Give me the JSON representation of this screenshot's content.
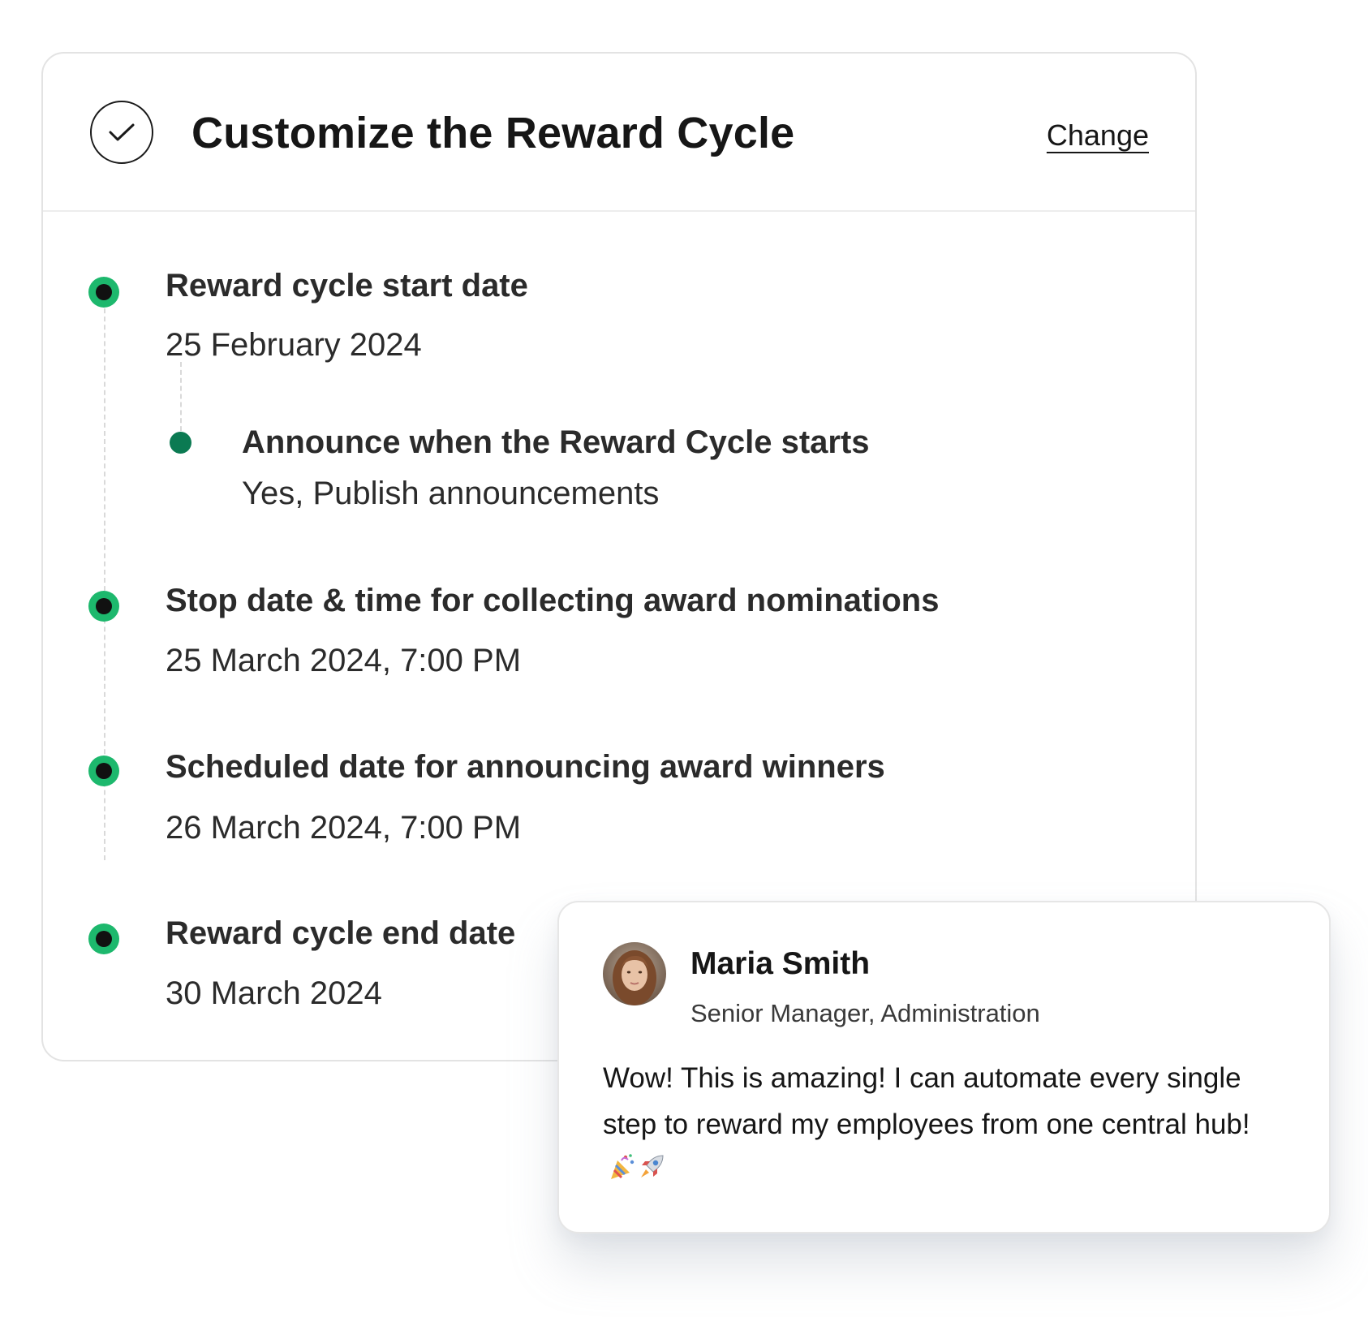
{
  "card": {
    "title": "Customize the Reward Cycle",
    "change_label": "Change",
    "steps": [
      {
        "label": "Reward cycle start date",
        "value": "25 February 2024"
      },
      {
        "label": "Stop date & time for collecting award nominations",
        "value": "25 March 2024, 7:00 PM"
      },
      {
        "label": "Scheduled date for announcing award winners",
        "value": "26 March 2024, 7:00 PM"
      },
      {
        "label": "Reward cycle end date",
        "value": "30 March 2024"
      }
    ],
    "sub_step": {
      "label": "Announce when the Reward Cycle starts",
      "value": "Yes, Publish announcements"
    }
  },
  "testimonial": {
    "name": "Maria Smith",
    "role": "Senior Manager, Administration",
    "quote": "Wow! This is amazing! I can automate every single step to reward my employees from one central hub!",
    "emoji_icons": [
      "party-popper-icon",
      "rocket-icon"
    ]
  },
  "colors": {
    "dot_green": "#1db86d",
    "sub_dot_green": "#0b7a52",
    "text_dark": "#2b2b2b"
  }
}
